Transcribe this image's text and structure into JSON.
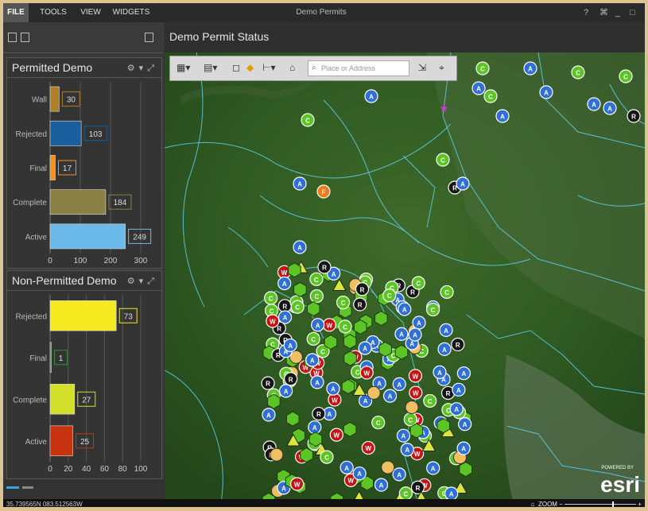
{
  "menu": {
    "file": "FILE",
    "tools": "TOOLS",
    "view": "VIEW",
    "widgets": "WIDGETS"
  },
  "app_title": "Demo Permits",
  "window_controls": {
    "help": "?",
    "restore": "⌘",
    "minimize": "_",
    "maximize": "□"
  },
  "main": {
    "title": "Demo Permit Status"
  },
  "search": {
    "placeholder": "Place or Address"
  },
  "status": {
    "coordinates": "35.739565N 083.512563W",
    "zoom_label": "ZOOM"
  },
  "esri": {
    "powered": "POWERED BY",
    "logo": "esri"
  },
  "colors": {
    "water_lines": "#5fd0ee",
    "green_marker": "#5cc424",
    "blue_marker": "#2f6fd6",
    "red_marker": "#c41414",
    "black_marker": "#151515"
  },
  "chart_data": [
    {
      "type": "bar",
      "title": "Permitted Demo",
      "orientation": "horizontal",
      "categories": [
        "Wall",
        "Rejected",
        "Final",
        "Complete",
        "Active"
      ],
      "values": [
        30,
        103,
        17,
        184,
        249
      ],
      "colors": [
        "#b07e27",
        "#1a5f9d",
        "#f39223",
        "#8a8043",
        "#6ab9e8"
      ],
      "xticks": [
        "0",
        "100",
        "200",
        "300"
      ],
      "xlim": [
        0,
        300
      ]
    },
    {
      "type": "bar",
      "title": "Non-Permitted Demo",
      "orientation": "horizontal",
      "categories": [
        "Rejected",
        "Final",
        "Complete",
        "Active"
      ],
      "values": [
        73,
        1,
        27,
        25
      ],
      "colors": [
        "#f5e91f",
        "#3d8a3d",
        "#d2e02c",
        "#c8330f"
      ],
      "xticks": [
        "0",
        "20",
        "40",
        "60",
        "80",
        "100"
      ],
      "xlim": [
        0,
        100
      ]
    }
  ]
}
